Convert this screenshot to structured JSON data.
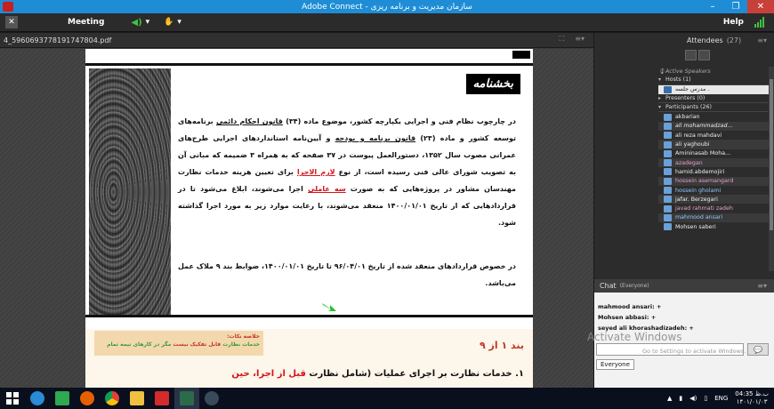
{
  "window": {
    "title": "Adobe Connect - سازمان مدیریت و برنامه ریزی",
    "controls": {
      "minimize": "–",
      "maximize": "❐",
      "close": "✕"
    }
  },
  "menubar": {
    "meeting_label": "Meeting",
    "help_label": "Help"
  },
  "document": {
    "filename": "4_5960693778191747804.pdf",
    "badge": "بخشنامه",
    "para1_a": "در چارچوب نظام فنی و اجرایی یکپارچه کشور، موضوع ماده (۳۴) ",
    "para1_link1": "قانون احکام دائمی",
    "para1_b": " برنامه‌های توسعه کشور و ماده (۲۳) ",
    "para1_link2": "قانون برنامه و بودجه",
    "para1_c": " و آیین‌نامه استانداردهای اجرایی طرح‌های عمرانی مصوب سال ۱۳۵۲، دستورالعمل پیوست در ۳۷ صفحه که به همراه ۳ ضمیمه که مبانی آن به تصویب شورای عالی فنی رسیده است، از نوع ",
    "para1_red1": "لازم الاجرا",
    "para1_d": " برای تعیین هزینه خدمات نظارت مهندسان مشاور در پروژه‌هایی که به صورت ",
    "para1_red2": "سه عاملی",
    "para1_e": " اجرا می‌شوند، ابلاغ می‌شود تا در قراردادهایی که از تاریخ ۱۴۰۰/۰۱/۰۱ منعقد می‌شوند، با رعایت موارد زیر به مورد اجرا گذاشته شود.",
    "para2": "در خصوص قراردادهای منعقد شده از تاریخ ۹۶/۰۴/۰۱ تا تاریخ ۱۴۰۰/۰۱/۰۱، ضوابط بند ۹ ملاک عمل می‌باشد.",
    "note_title": "خلاصه نکات:",
    "note_body_a": "خدمات نظارت ",
    "note_red": "قابل تفکیک نیست",
    "note_body_b": " مگر در کارهای نیمه تمام",
    "band_heading": "بند ۱ از ۹",
    "band_line_a": "۱. خدمات نظارت بر اجرای عملیات (شامل نظارت ",
    "band_line_red": "قبل از اجرا، حین"
  },
  "attendees": {
    "title": "Attendees",
    "count": "(27)",
    "active_speakers": "Active Speakers",
    "hosts_label": "Hosts (1)",
    "host_name": "مدرس جلسه .",
    "presenters_label": "Presenters (0)",
    "participants_label": "Participants (26)",
    "participants": [
      "akbarian",
      "ali mohammadzad...",
      "ali reza mahdavi",
      "ali yaghoubi",
      "Amininasab Moha...",
      "azadegan",
      "hamid.abdemojiri",
      "hossein asemangard",
      "hossein gholami",
      "jafar. Berzegari",
      "javad rahmati zadeh",
      "mahmood ansari",
      "Mohsen saberi"
    ]
  },
  "chat": {
    "title": "Chat",
    "scope": "(Everyone)",
    "messages": [
      "mahmood ansari: +",
      "Mohsen abbasi: +",
      "seyed ali khorashadizadeh: +"
    ],
    "send_icon": "💬",
    "recipient": "Everyone",
    "watermark_title": "Activate Windows",
    "watermark_sub": "Go to Settings to activate Windows."
  },
  "taskbar": {
    "lang": "ENG",
    "time": "04:35 ب.ظ",
    "date": "۱۴۰۱/۰۱/۰۳"
  },
  "colors": {
    "titlebar": "#1e8dd6",
    "accent_red": "#d4141c",
    "note_green": "#3a9a3a"
  }
}
